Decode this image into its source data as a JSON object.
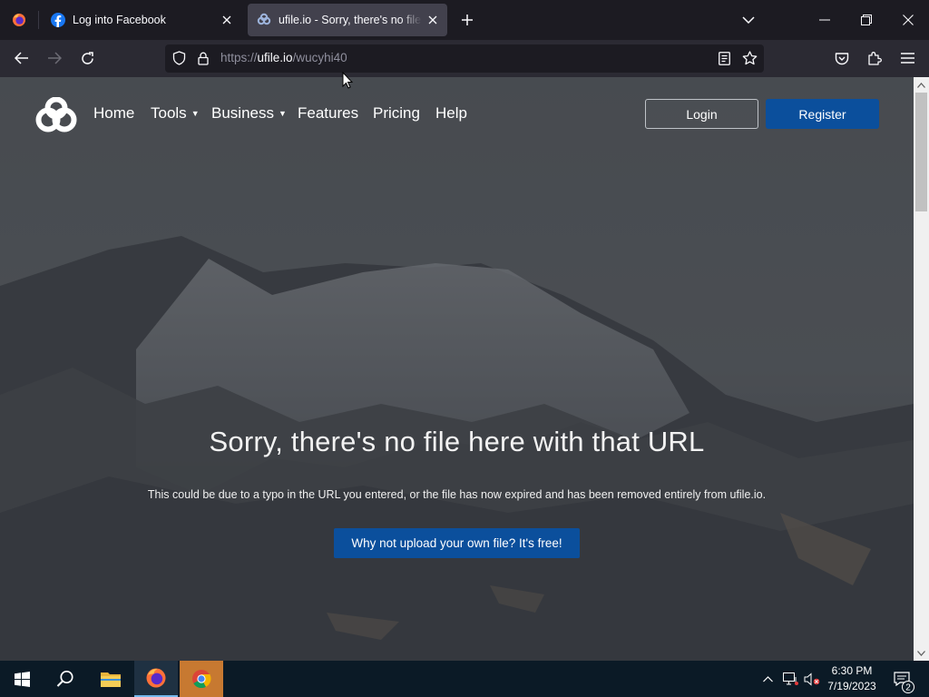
{
  "browser": {
    "tabs": [
      {
        "title": "Log into Facebook",
        "favicon": "facebook-icon",
        "active": false
      },
      {
        "title": "ufile.io - Sorry, there's no file here",
        "favicon": "ufile-icon",
        "active": true
      }
    ],
    "url": {
      "scheme": "https://",
      "host": "ufile.io",
      "path": "/wucyhi40"
    }
  },
  "site": {
    "nav": {
      "home": "Home",
      "tools": "Tools",
      "business": "Business",
      "features": "Features",
      "pricing": "Pricing",
      "help": "Help"
    },
    "login_label": "Login",
    "register_label": "Register",
    "headline": "Sorry, there's no file here with that URL",
    "subtext": "This could be due to a typo in the URL you entered, or the file has now expired and has been removed entirely from ufile.io.",
    "cta_label": "Why not upload your own file? It's free!"
  },
  "taskbar": {
    "time": "6:30 PM",
    "date": "7/19/2023",
    "notification_count": "2"
  },
  "colors": {
    "accent_blue": "#0b4f9c",
    "chrome_dark": "#1c1b22",
    "chrome_toolbar": "#2b2a33",
    "taskbar": "#0b1a26"
  }
}
